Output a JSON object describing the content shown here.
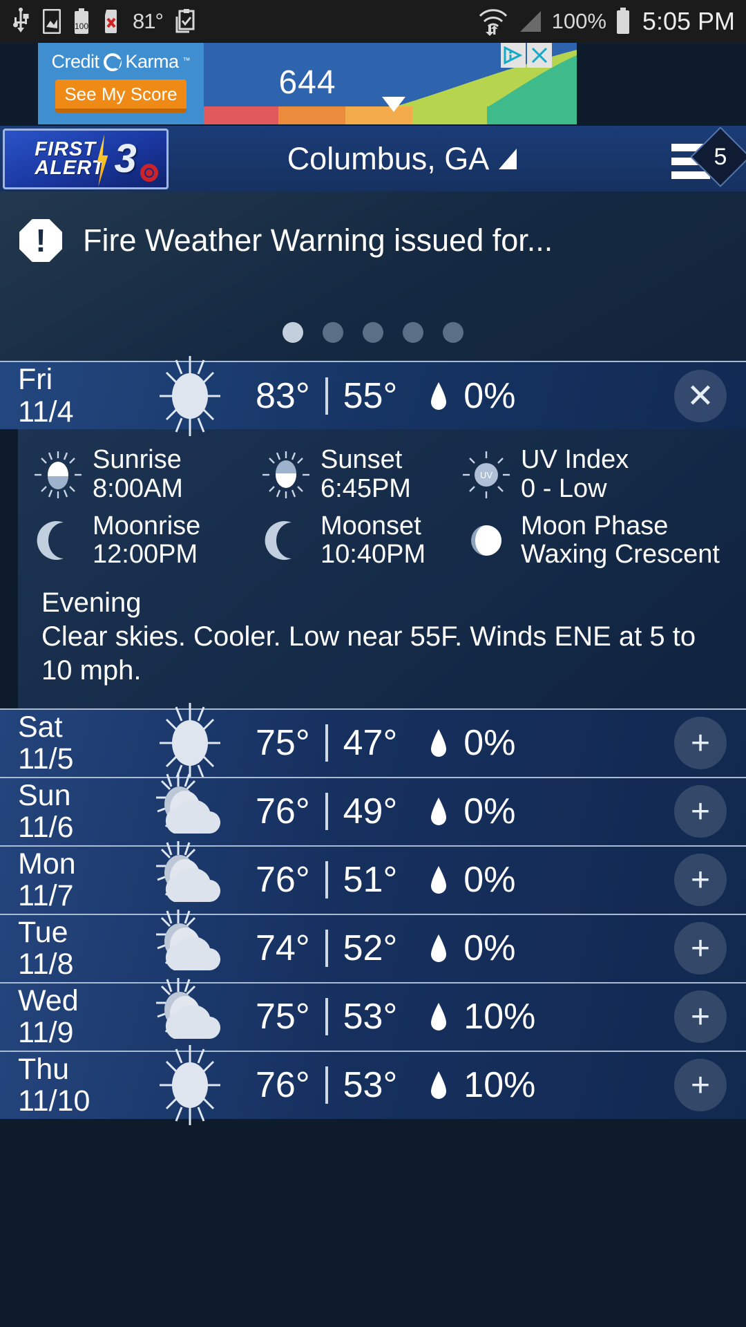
{
  "status_bar": {
    "icons": [
      "usb-icon",
      "screenshot-icon",
      "battery-saver-icon",
      "sd-card-error-icon",
      "clipboard-icon",
      "wifi-icon",
      "signal-icon",
      "battery-icon"
    ],
    "temperature": "81°",
    "battery_percent": "100%",
    "battery_level_label": "100",
    "time": "5:05 PM"
  },
  "ad": {
    "brand": "Credit Karma",
    "trademark": "™",
    "cta_label": "See My Score",
    "score": "644",
    "adchoices_label": "AdChoices",
    "close_label": "✕",
    "bar_colors": [
      "#e05a5d",
      "#ea8c3c",
      "#f4ab4b",
      "#b7d44f",
      "#3fba8a"
    ],
    "background": "#2e63ae",
    "panel_background": "#3f8ed0",
    "cta_color": "#ef8a17"
  },
  "header": {
    "logo": {
      "line1": "FIRST",
      "line2": "ALERT",
      "channel": "3",
      "network_icon": "cbs-eye-icon"
    },
    "city": "Columbus, GA",
    "menu_badge": "5"
  },
  "alert": {
    "icon": "warning-octagon-icon",
    "text": "Fire Weather Warning issued for...",
    "carousel": {
      "count": 5,
      "active_index": 0
    }
  },
  "selected_day": {
    "day": "Fri",
    "date": "11/4",
    "condition_icon": "sunny-icon",
    "high": "83°",
    "low": "55°",
    "precip": "0%",
    "action": "✕",
    "details": [
      {
        "icon": "sunrise-icon",
        "label": "Sunrise",
        "value": "8:00AM"
      },
      {
        "icon": "sunset-icon",
        "label": "Sunset",
        "value": "6:45PM"
      },
      {
        "icon": "uv-index-icon",
        "label": "UV Index",
        "value": "0 - Low"
      },
      {
        "icon": "moonrise-icon",
        "label": "Moonrise",
        "value": "12:00PM"
      },
      {
        "icon": "moonset-icon",
        "label": "Moonset",
        "value": "10:40PM"
      },
      {
        "icon": "moon-phase-icon",
        "label": "Moon Phase",
        "value": "Waxing Crescent"
      }
    ],
    "period_label": "Evening",
    "period_text": "Clear skies. Cooler. Low near 55F. Winds ENE at 5 to 10 mph."
  },
  "forecast_rows": [
    {
      "day": "Sat",
      "date": "11/5",
      "condition_icon": "sunny-icon",
      "high": "75°",
      "low": "47°",
      "precip": "0%",
      "action": "+"
    },
    {
      "day": "Sun",
      "date": "11/6",
      "condition_icon": "partly-cloudy-icon",
      "high": "76°",
      "low": "49°",
      "precip": "0%",
      "action": "+"
    },
    {
      "day": "Mon",
      "date": "11/7",
      "condition_icon": "partly-cloudy-icon",
      "high": "76°",
      "low": "51°",
      "precip": "0%",
      "action": "+"
    },
    {
      "day": "Tue",
      "date": "11/8",
      "condition_icon": "partly-cloudy-icon",
      "high": "74°",
      "low": "52°",
      "precip": "0%",
      "action": "+"
    },
    {
      "day": "Wed",
      "date": "11/9",
      "condition_icon": "partly-cloudy-icon",
      "high": "75°",
      "low": "53°",
      "precip": "10%",
      "action": "+"
    },
    {
      "day": "Thu",
      "date": "11/10",
      "condition_icon": "sunny-icon",
      "high": "76°",
      "low": "53°",
      "precip": "10%",
      "action": "+"
    }
  ]
}
